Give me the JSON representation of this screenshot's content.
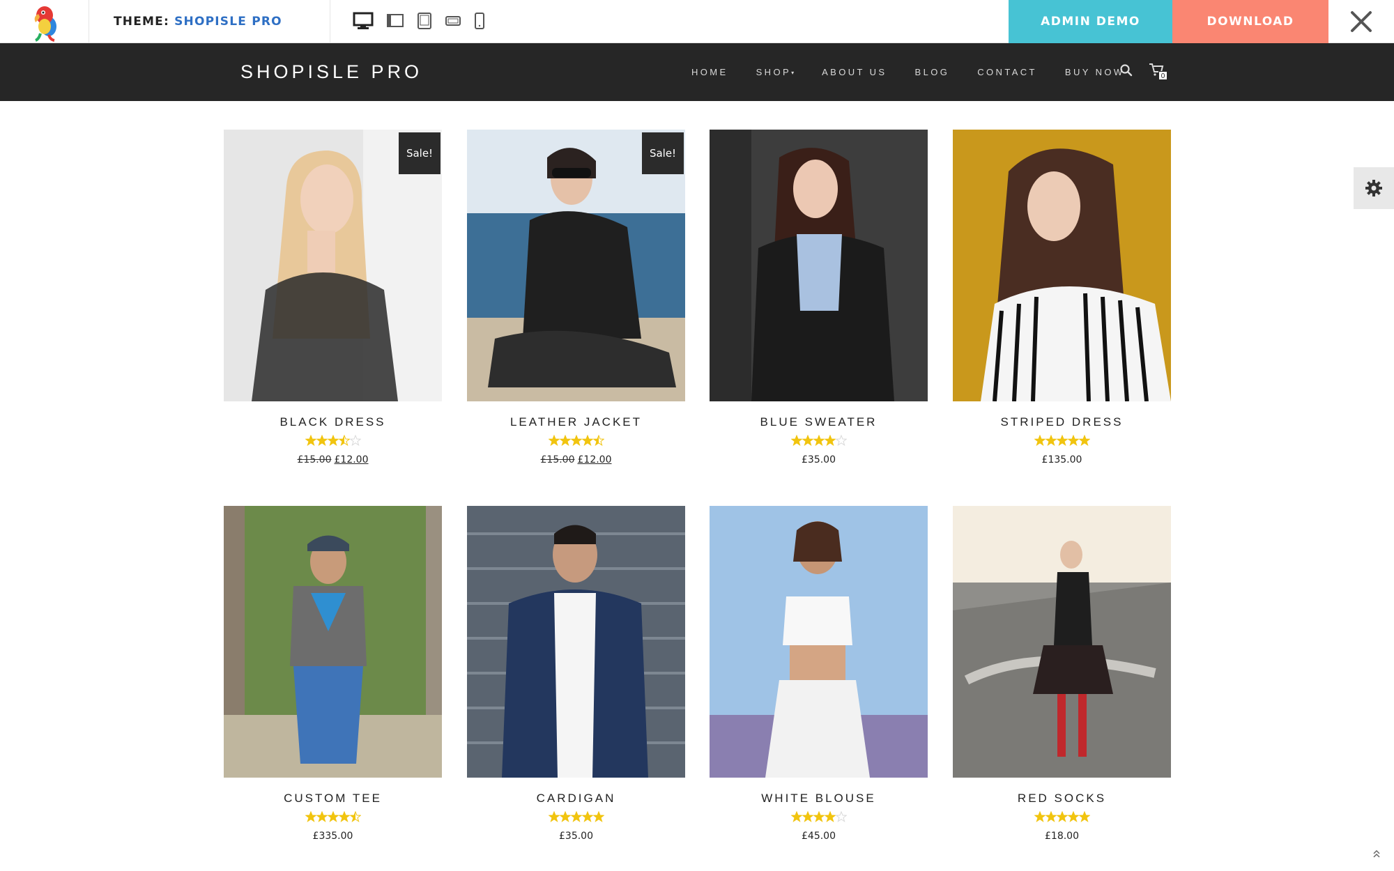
{
  "preview_bar": {
    "theme_label": "THEME:",
    "theme_name": "SHOPISLE PRO",
    "devices": [
      "desktop-icon",
      "laptop-icon",
      "tablet-icon",
      "tablet-landscape-icon",
      "phone-icon"
    ],
    "admin_demo_label": "ADMIN DEMO",
    "download_label": "DOWNLOAD",
    "colors": {
      "admin_demo": "#47c3d4",
      "download": "#fa8672",
      "theme_name": "#2e6fc4"
    }
  },
  "site_header": {
    "title": "SHOPISLE PRO",
    "nav": [
      {
        "label": "HOME"
      },
      {
        "label": "SHOP",
        "has_dropdown": true
      },
      {
        "label": "ABOUT US"
      },
      {
        "label": "BLOG"
      },
      {
        "label": "CONTACT"
      },
      {
        "label": "BUY NOW"
      }
    ],
    "cart_count": "0",
    "background": "#262626"
  },
  "products": [
    {
      "name": "BLACK DRESS",
      "rating": 3.5,
      "sale": true,
      "sale_label": "Sale!",
      "old_price": "£15.00",
      "price": "£12.00",
      "photo_bg": "#e6e6e6"
    },
    {
      "name": "LEATHER JACKET",
      "rating": 4.5,
      "sale": true,
      "sale_label": "Sale!",
      "old_price": "£15.00",
      "price": "£12.00",
      "photo_bg": "#6f93b3"
    },
    {
      "name": "BLUE SWEATER",
      "rating": 4,
      "sale": false,
      "price": "£35.00",
      "photo_bg": "#3d3d3d"
    },
    {
      "name": "STRIPED DRESS",
      "rating": 5,
      "sale": false,
      "price": "£135.00",
      "photo_bg": "#c9981c"
    },
    {
      "name": "CUSTOM TEE",
      "rating": 4.5,
      "sale": false,
      "price": "£335.00",
      "photo_bg": "#6c8a4a"
    },
    {
      "name": "CARDIGAN",
      "rating": 5,
      "sale": false,
      "price": "£35.00",
      "photo_bg": "#5a6470"
    },
    {
      "name": "WHITE BLOUSE",
      "rating": 4,
      "sale": false,
      "price": "£45.00",
      "photo_bg": "#9fc3e6"
    },
    {
      "name": "RED SOCKS",
      "rating": 5,
      "sale": false,
      "price": "£18.00",
      "photo_bg": "#b5b2ab"
    }
  ],
  "colors": {
    "star": "#f1c40f",
    "star_empty": "#d9d9d9"
  }
}
